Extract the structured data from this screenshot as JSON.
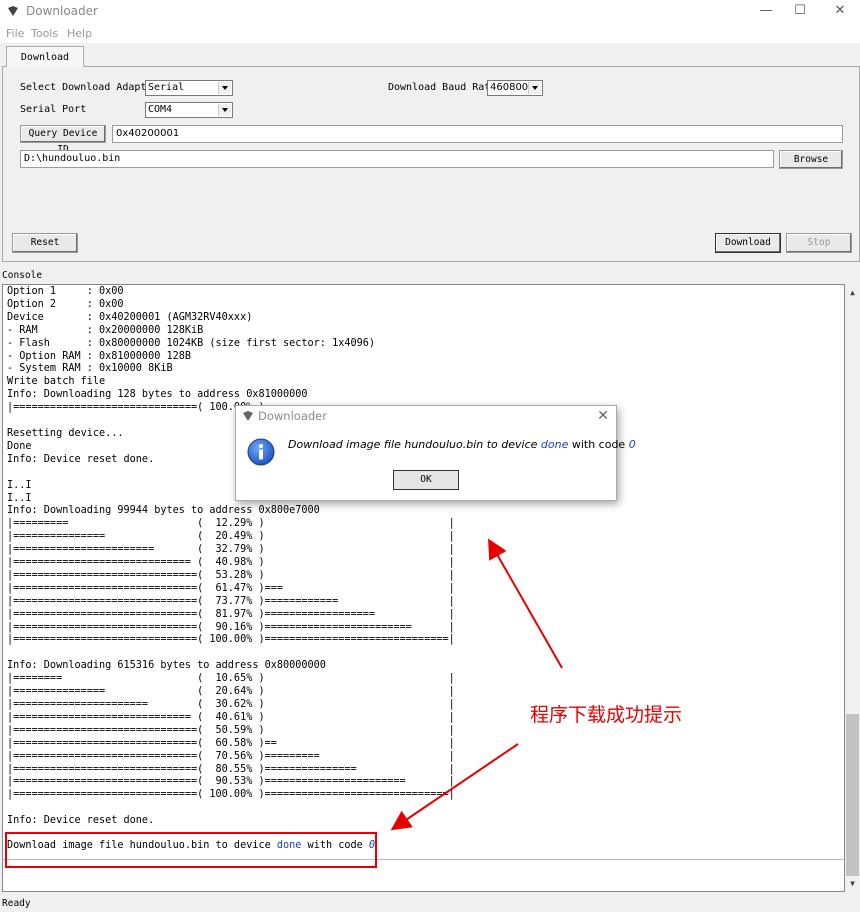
{
  "window": {
    "title": "Downloader",
    "controls": [
      "—",
      "☐",
      "✕"
    ]
  },
  "menu": [
    "File",
    "Tools",
    "Help"
  ],
  "tabs": [
    {
      "label": "Download"
    }
  ],
  "form": {
    "adapter_label": "Select Download Adapter",
    "adapter_value": "Serial",
    "baud_label": "Download Baud Rate",
    "baud_value": "460800",
    "port_label": "Serial Port",
    "port_value": "COM4",
    "query_button": "Query Device ID",
    "device_id": "0x40200001",
    "file_path": "D:\\hundouluo.bin",
    "browse_button": "Browse",
    "reset_button": "Reset",
    "download_button": "Download",
    "stop_button": "Stop"
  },
  "console": {
    "label": "Console",
    "text": "Option 1     : 0x00\nOption 2     : 0x00\nDevice       : 0x40200001 (AGM32RV40xxx)\n- RAM        : 0x20000000 128KiB\n- Flash      : 0x80000000 1024KB (size first sector: 1x4096)\n- Option RAM : 0x81000000 128B\n- System RAM : 0x10000 8KiB\nWrite batch file\nInfo: Downloading 128 bytes to address 0x81000000\n|==============================( 100.00% )\n\nResetting device...\nDone\nInfo: Device reset done.\n\nI..I\nI..I\nInfo: Downloading 99944 bytes to address 0x800e7000\n|=========                     (  12.29% )                              |\n|===============               (  20.49% )                              |\n|=======================       (  32.79% )                              |\n|============================= (  40.98% )                              |\n|==============================(  53.28% )                              |\n|==============================(  61.47% )===                           |\n|==============================(  73.77% )============                  |\n|==============================(  81.97% )==================            |\n|==============================(  90.16% )========================      |\n|==============================( 100.00% )==============================|\n\nInfo: Downloading 615316 bytes to address 0x80000000\n|========                      (  10.65% )                              |\n|===============               (  20.64% )                              |\n|======================        (  30.62% )                              |\n|============================= (  40.61% )                              |\n|==============================(  50.59% )                              |\n|==============================(  60.58% )==                            |\n|==============================(  70.56% )=========                     |\n|==============================(  80.55% )===============               |\n|==============================(  90.53% )=======================       |\n|==============================( 100.00% )==============================|\n\nInfo: Device reset done.\n",
    "final_pre": "Download image file hundouluo.bin to device ",
    "final_done": "done",
    "final_mid": " with code ",
    "final_code": "0"
  },
  "dialog": {
    "title": "Downloader",
    "msg_pre": "Download image file hundouluo.bin to device ",
    "msg_done": "done",
    "msg_mid": " with code ",
    "msg_code": "0",
    "ok": "OK"
  },
  "status": "Ready",
  "annotation": {
    "text": "程序下载成功提示",
    "color": "#e60000"
  }
}
